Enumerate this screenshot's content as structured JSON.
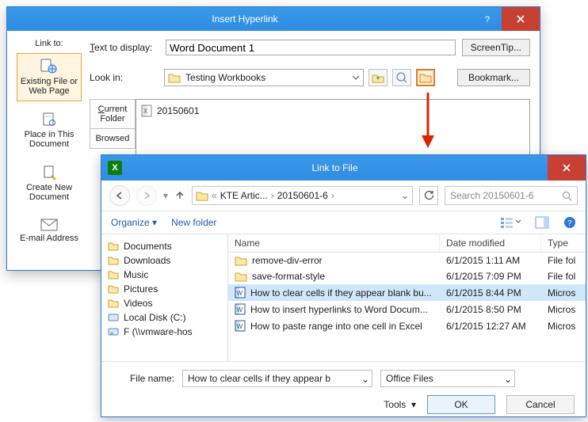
{
  "hyperlink": {
    "title": "Insert Hyperlink",
    "link_to_label": "Link to:",
    "text_to_display_label": "Text to display:",
    "text_to_display_value": "Word Document 1",
    "screentip_label": "ScreenTip...",
    "look_in_label": "Look in:",
    "look_in_value": "Testing Workbooks",
    "bookmark_label": "Bookmark...",
    "tabs": {
      "existing": "Existing File or Web Page",
      "place": "Place in This Document",
      "createnew": "Create New Document",
      "email": "E-mail Address"
    },
    "subtabs": {
      "current": "Current Folder",
      "browsed": "Browsed"
    },
    "files_in_folder": {
      "0": {
        "name": "20150601"
      }
    }
  },
  "linktofile": {
    "title": "Link to File",
    "breadcrumb": {
      "a": "KTE Artic...",
      "b": "20150601-6"
    },
    "search_placeholder": "Search 20150601-6",
    "organize_label": "Organize",
    "newfolder_label": "New folder",
    "headers": {
      "name": "Name",
      "date": "Date modified",
      "type": "Type"
    },
    "tree": {
      "0": "Documents",
      "1": "Downloads",
      "2": "Music",
      "3": "Pictures",
      "4": "Videos",
      "5": "Local Disk (C:)",
      "6": "F (\\\\vmware-hos"
    },
    "rows": {
      "0": {
        "name": "remove-div-error",
        "date": "6/1/2015 1:11 AM",
        "type": "File fol"
      },
      "1": {
        "name": "save-format-style",
        "date": "6/1/2015 7:09 PM",
        "type": "File fol"
      },
      "2": {
        "name": "How to clear cells if they appear blank bu...",
        "date": "6/1/2015 8:44 PM",
        "type": "Micros"
      },
      "3": {
        "name": "How to insert hyperlinks to Word Docum...",
        "date": "6/1/2015 8:50 PM",
        "type": "Micros"
      },
      "4": {
        "name": "How to paste range into one cell in Excel",
        "date": "6/1/2015 12:27 AM",
        "type": "Micros"
      }
    },
    "filename_label": "File name:",
    "filename_value": "How to clear cells if they appear b",
    "filter_value": "Office Files",
    "tools_label": "Tools",
    "ok_label": "OK",
    "cancel_label": "Cancel"
  }
}
